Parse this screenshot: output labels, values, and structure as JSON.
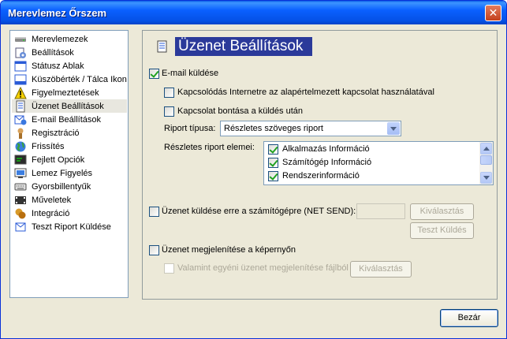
{
  "window": {
    "title": "Merevlemez Őrszem",
    "close_glyph": "✕"
  },
  "sidebar": {
    "items": [
      {
        "label": "Merevlemezek",
        "icon": "disk-icon"
      },
      {
        "label": "Beállítások",
        "icon": "settings-icon"
      },
      {
        "label": "Státusz Ablak",
        "icon": "window-icon"
      },
      {
        "label": "Küszöbérték / Tálca Ikon",
        "icon": "tray-icon"
      },
      {
        "label": "Figyelmeztetések",
        "icon": "warning-icon"
      },
      {
        "label": "Üzenet Beállítások",
        "icon": "message-icon",
        "selected": true
      },
      {
        "label": "E-mail Beállítások",
        "icon": "email-icon"
      },
      {
        "label": "Regisztráció",
        "icon": "registration-icon"
      },
      {
        "label": "Frissítés",
        "icon": "update-globe-icon"
      },
      {
        "label": "Fejlett Opciók",
        "icon": "advanced-options-icon"
      },
      {
        "label": "Lemez Figyelés",
        "icon": "disk-monitor-icon"
      },
      {
        "label": "Gyorsbillentyűk",
        "icon": "keyboard-icon"
      },
      {
        "label": "Műveletek",
        "icon": "actions-icon"
      },
      {
        "label": "Integráció",
        "icon": "integration-icon"
      },
      {
        "label": "Teszt Riport Küldése",
        "icon": "test-report-icon"
      }
    ]
  },
  "panel": {
    "title": "Üzenet Beállítások",
    "email_send": {
      "label": "E-mail küldése",
      "checked": true
    },
    "connect_default": {
      "label": "Kapcsolódás Internetre az alapértelmezett kapcsolat használatával",
      "checked": false
    },
    "disconnect_after": {
      "label": "Kapcsolat bontása a küldés után",
      "checked": false
    },
    "report_type": {
      "label": "Riport típusa:",
      "value": "Részletes szöveges riport"
    },
    "report_elements": {
      "label": "Részletes riport elemei:",
      "items": [
        {
          "label": "Alkalmazás Információ",
          "checked": true
        },
        {
          "label": "Számítógép Információ",
          "checked": true
        },
        {
          "label": "Rendszerinformáció",
          "checked": true
        }
      ]
    },
    "net_send": {
      "label": "Üzenet küldése erre a számítógépre (NET SEND):",
      "checked": false,
      "value": ""
    },
    "select_button": "Kiválasztás",
    "test_send_button": "Teszt Küldés",
    "show_message": {
      "label": "Üzenet megjelenítése a képernyőn",
      "checked": false
    },
    "custom_message": {
      "label": "Valamint egyéni üzenet megjelenítése fájlból",
      "checked": false
    },
    "select_button_2": "Kiválasztás"
  },
  "footer": {
    "close_button": "Bezár"
  }
}
